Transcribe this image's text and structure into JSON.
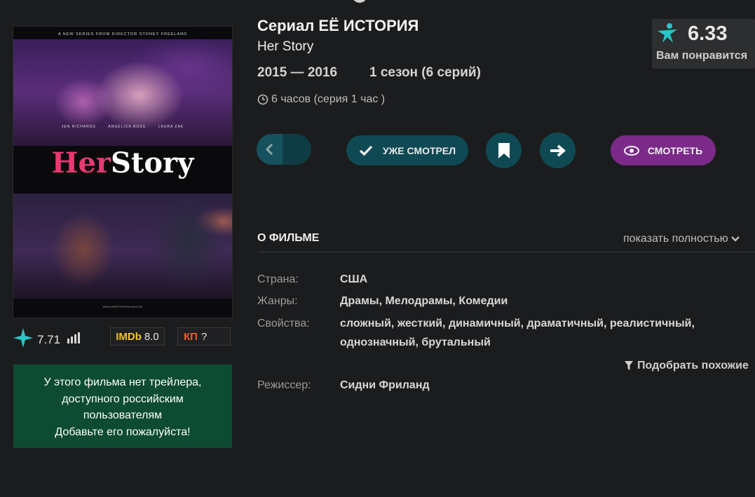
{
  "colors": {
    "background": "#1b1c1e",
    "teal_button": "#0f4a54",
    "purple_button": "#7b2a8a",
    "trailer_box": "#0d4b33",
    "star_teal": "#28c6c8",
    "imdb_yellow": "#f3c233",
    "kp_orange": "#f05a24"
  },
  "poster": {
    "tagline": "A NEW SERIES FROM DIRECTOR SYDNEY FREELAND",
    "cast": [
      "JEN RICHARDS",
      "ANGELICA ROSS",
      "LAURA ZAK"
    ],
    "logo_her": "Her",
    "logo_story": "Story",
    "url": "WWW.HERSTORYSHOW.COM"
  },
  "ratings": {
    "our": "7.71",
    "imdb_label": "IMDb",
    "imdb_value": "8.0",
    "kp_label": "КП",
    "kp_value": "?"
  },
  "trailer": {
    "line1": "У этого фильма нет трейлера,",
    "line2": "доступного российским",
    "line3": "пользователям",
    "line4": "Добавьте его пожалуйста!"
  },
  "header": {
    "title": "Сериал ЕЁ ИСТОРИЯ",
    "original_title": "Her Story",
    "years": "2015 — 2016",
    "season": "1 сезон (6 серий)",
    "duration": "6 часов  (серия 1 час )"
  },
  "score": {
    "value": "6.33",
    "caption": "Вам понравится"
  },
  "actions": {
    "watched_label": "УЖЕ СМОТРЕЛ",
    "watch_label": "СМОТРЕТЬ",
    "icons": [
      "chevron-left-icon",
      "check-icon",
      "bookmark-icon",
      "arrow-right-icon",
      "eye-icon"
    ]
  },
  "about": {
    "heading": "О ФИЛЬМЕ",
    "show_full": "показать полностью",
    "country_label": "Страна:",
    "country": "США",
    "genres_label": "Жанры:",
    "genres": "Драмы,  Мелодрамы,  Комедии",
    "props_label": "Свойства:",
    "props_line1": "сложный,  жесткий,  динамичный,  драматичный,  реалистичный,",
    "props_line2": "однозначный,  брутальный",
    "similar": "Подобрать похожие",
    "director_label": "Режиссер:",
    "director": "Сидни Фриланд"
  }
}
